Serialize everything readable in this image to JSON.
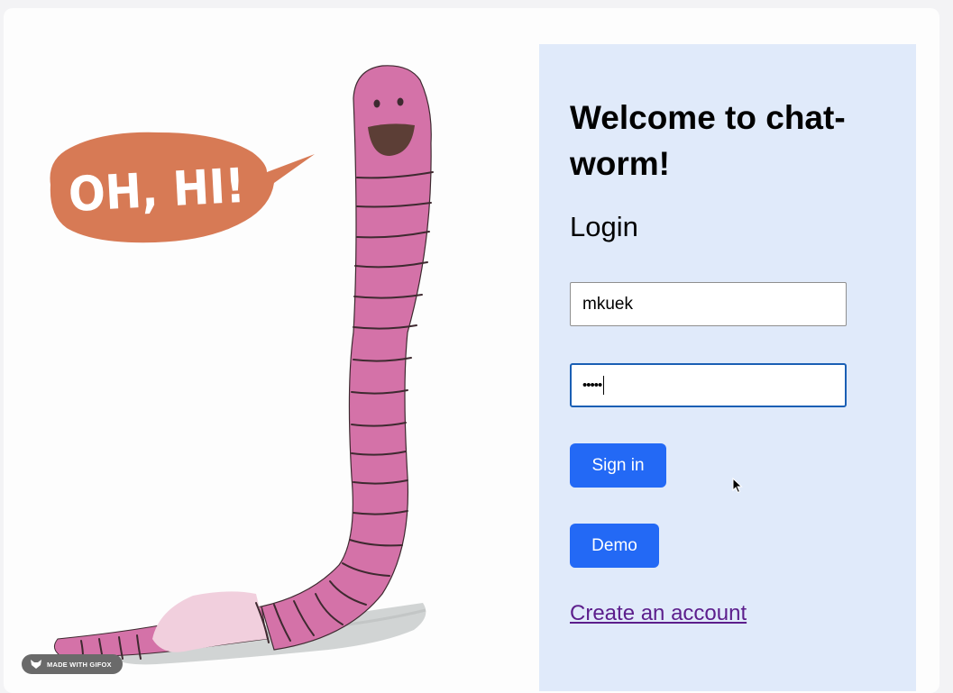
{
  "illustration": {
    "speech_bubble_text": "OH, HI!",
    "badge_text": "MADE WITH GIFOX",
    "colors": {
      "worm_pink": "#d472a8",
      "worm_band": "#3e2a30",
      "clitellum": "#f1cfdd",
      "bubble": "#d77a55",
      "shadow": "#c9cdcc",
      "mouth": "#5c3e36"
    }
  },
  "login_panel": {
    "background": "#e0eafa",
    "welcome_title": "Welcome to chat-worm!",
    "login_heading": "Login",
    "username_value": "mkuek",
    "password_mask": "•••••",
    "signin_label": "Sign in",
    "demo_label": "Demo",
    "create_account_label": "Create an account",
    "accent_color": "#2369f5",
    "link_color": "#5c1e8c"
  }
}
